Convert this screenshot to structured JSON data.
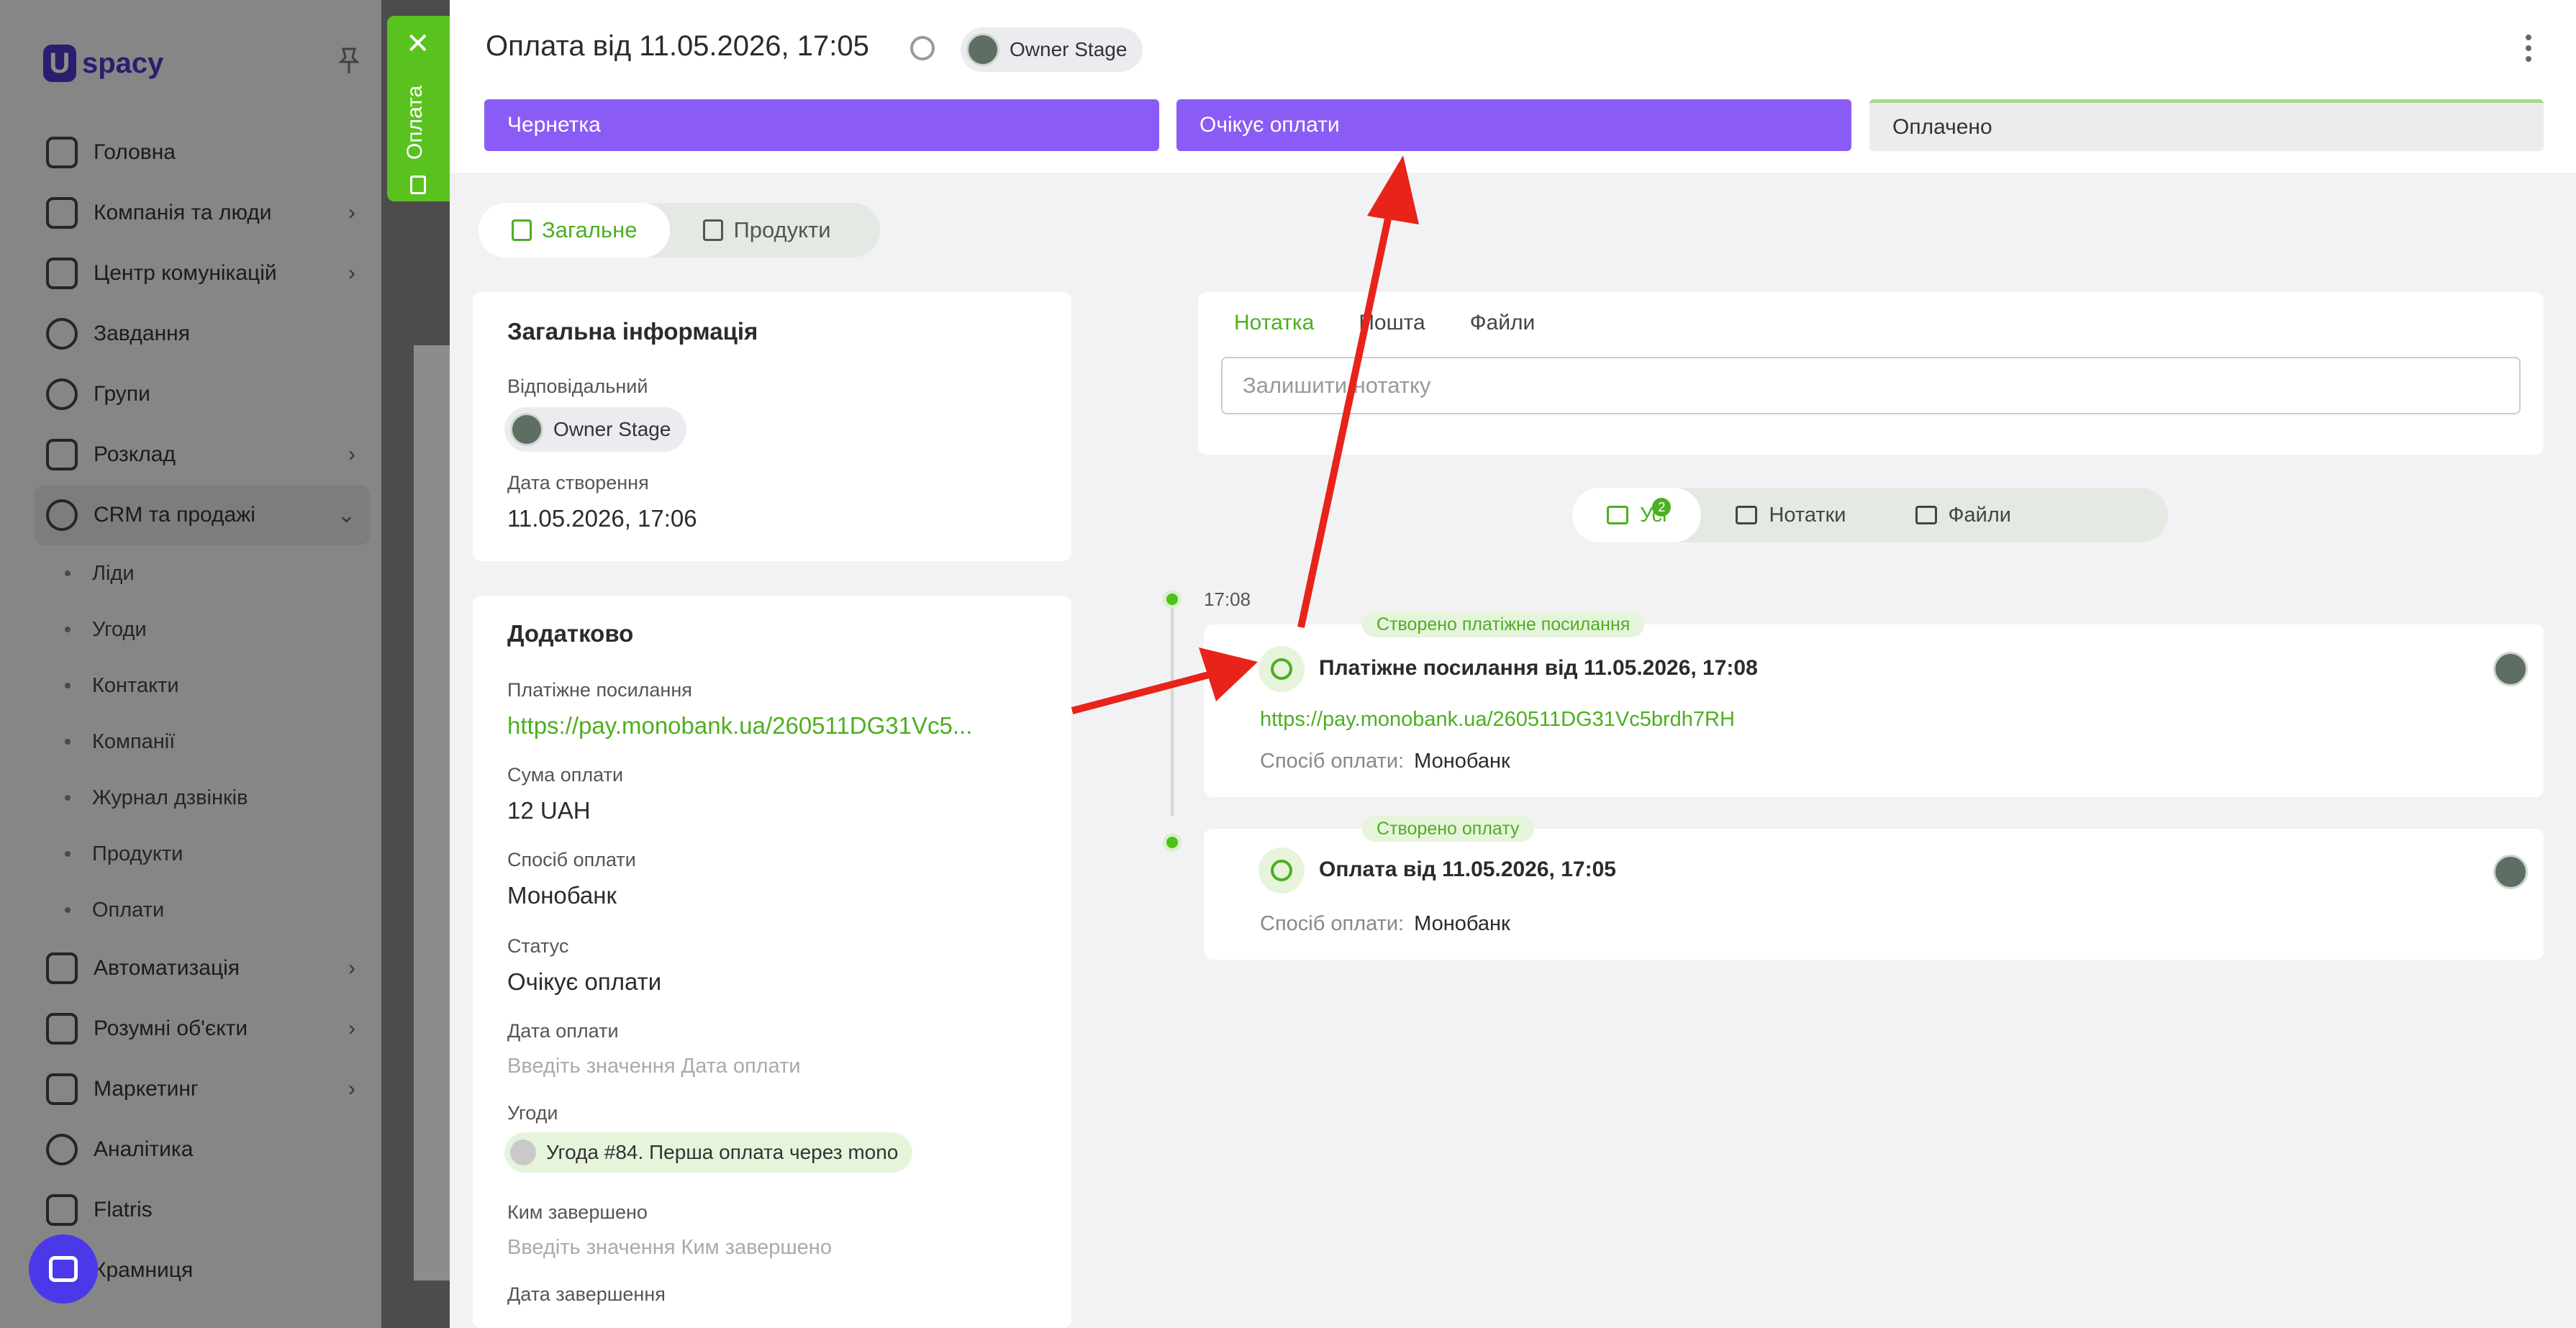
{
  "sidebar": {
    "logo_u": "U",
    "logo_text": "spacy",
    "items": [
      {
        "label": "Головна"
      },
      {
        "label": "Компанія та люди"
      },
      {
        "label": "Центр комунікацій"
      },
      {
        "label": "Завдання"
      },
      {
        "label": "Групи"
      },
      {
        "label": "Розклад"
      },
      {
        "label": "CRM та продажі"
      },
      {
        "label": "Автоматизація"
      },
      {
        "label": "Розумні об'єкти"
      },
      {
        "label": "Маркетинг"
      },
      {
        "label": "Аналітика"
      },
      {
        "label": "Flatris"
      },
      {
        "label": "Крамниця"
      }
    ],
    "crm_sub": [
      {
        "label": "Ліди"
      },
      {
        "label": "Угоди"
      },
      {
        "label": "Контакти"
      },
      {
        "label": "Компанії"
      },
      {
        "label": "Журнал дзвінків"
      },
      {
        "label": "Продукти"
      },
      {
        "label": "Оплати"
      }
    ]
  },
  "side_tab": {
    "label": "Оплата",
    "close": "✕"
  },
  "header": {
    "title": "Оплата від 11.05.2026, 17:05",
    "owner": "Owner Stage",
    "stages": [
      {
        "label": "Чернетка"
      },
      {
        "label": "Очікує оплати"
      },
      {
        "label": "Оплачено"
      }
    ]
  },
  "tabs": [
    {
      "label": "Загальне"
    },
    {
      "label": "Продукти"
    }
  ],
  "general": {
    "title": "Загальна інформація",
    "responsible_label": "Відповідальний",
    "responsible": "Owner Stage",
    "created_label": "Дата створення",
    "created": "11.05.2026, 17:06"
  },
  "extra": {
    "title": "Додатково",
    "link_label": "Платіжне посилання",
    "link": "https://pay.monobank.ua/260511DG31Vc5...",
    "amount_label": "Сума оплати",
    "amount": "12 UAH",
    "method_label": "Спосіб оплати",
    "method": "Монобанк",
    "status_label": "Статус",
    "status": "Очікує оплати",
    "paid_date_label": "Дата оплати",
    "paid_date_placeholder": "Введіть значення Дата оплати",
    "deals_label": "Угоди",
    "deal": "Угода #84. Перша оплата через mono",
    "completed_by_label": "Ким завершено",
    "completed_by_placeholder": "Введіть значення Ким завершено",
    "completed_date_label": "Дата завершення"
  },
  "note": {
    "tabs": [
      "Нотатка",
      "Пошта",
      "Файли"
    ],
    "placeholder": "Залишити нотатку"
  },
  "filters": [
    {
      "label": "Усі",
      "badge": "2"
    },
    {
      "label": "Нотатки"
    },
    {
      "label": "Файли"
    }
  ],
  "timeline": {
    "time": "17:08",
    "events": [
      {
        "tag": "Створено платіжне посилання",
        "title": "Платіжне посилання від 11.05.2026, 17:08",
        "link": "https://pay.monobank.ua/260511DG31Vc5brdh7RH",
        "meta_label": "Спосіб оплати:",
        "meta_value": "Монобанк"
      },
      {
        "tag": "Створено оплату",
        "title": "Оплата від 11.05.2026, 17:05",
        "meta_label": "Спосіб оплати:",
        "meta_value": "Монобанк"
      }
    ]
  },
  "colors": {
    "accent_green": "#4caf20",
    "stage_purple": "#8a5cf5",
    "annotation_red": "#e8231a"
  }
}
